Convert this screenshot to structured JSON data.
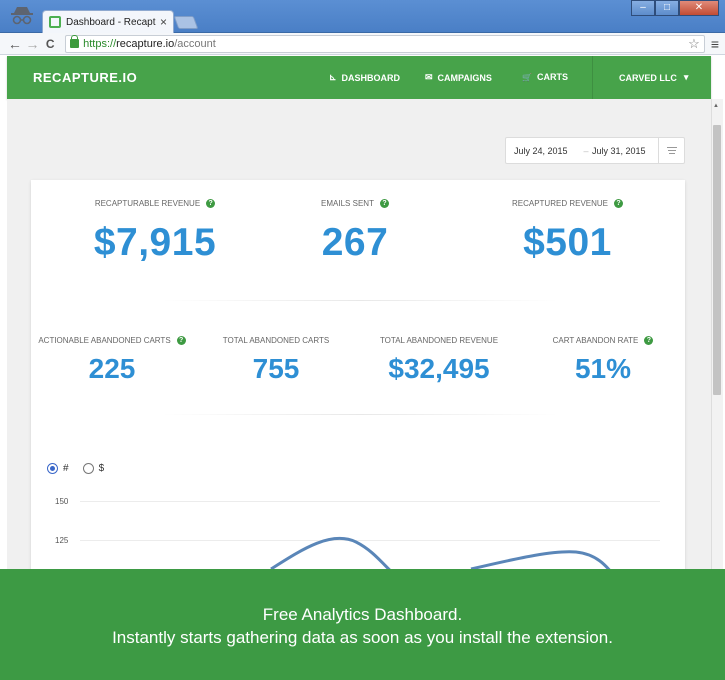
{
  "browser": {
    "tab_title": "Dashboard - Recapture.io",
    "tab_close": "×",
    "url_scheme": "https://",
    "url_host": "recapture.io",
    "url_path": "/account",
    "back": "←",
    "forward": "→",
    "reload": "C",
    "star": "☆",
    "menu": "≡",
    "min": "–",
    "max": "□",
    "close": "✕"
  },
  "header": {
    "logo": "RECAPTURE.IO",
    "nav": [
      {
        "icon": "⊾",
        "label": "DASHBOARD"
      },
      {
        "icon": "✉",
        "label": "CAMPAIGNS"
      },
      {
        "icon": "🛒",
        "label": "CARTS"
      }
    ],
    "account": "CARVED LLC",
    "account_caret": "▾",
    "brand_color": "#47a34a"
  },
  "date_range": {
    "start": "July 24, 2015",
    "separator": "–",
    "end": "July 31, 2015"
  },
  "metrics_top": [
    {
      "label": "RECAPTURABLE REVENUE",
      "value": "$7,915"
    },
    {
      "label": "EMAILS SENT",
      "value": "267"
    },
    {
      "label": "RECAPTURED REVENUE",
      "value": "$501"
    }
  ],
  "metrics_bottom": [
    {
      "label": "ACTIONABLE ABANDONED CARTS",
      "value": "225"
    },
    {
      "label": "TOTAL ABANDONED CARTS",
      "value": "755"
    },
    {
      "label": "TOTAL ABANDONED REVENUE",
      "value": "$32,495"
    },
    {
      "label": "CART ABANDON RATE",
      "value": "51%"
    }
  ],
  "help_icon": "?",
  "chart_toggle": {
    "options": [
      "#",
      "$"
    ],
    "selected": "#"
  },
  "chart_data": {
    "type": "line",
    "y_ticks": [
      "150",
      "125"
    ],
    "color": "#5a86b8"
  },
  "banner": {
    "line1": "Free Analytics Dashboard.",
    "line2": "Instantly starts gathering data as soon as you install the extension."
  }
}
